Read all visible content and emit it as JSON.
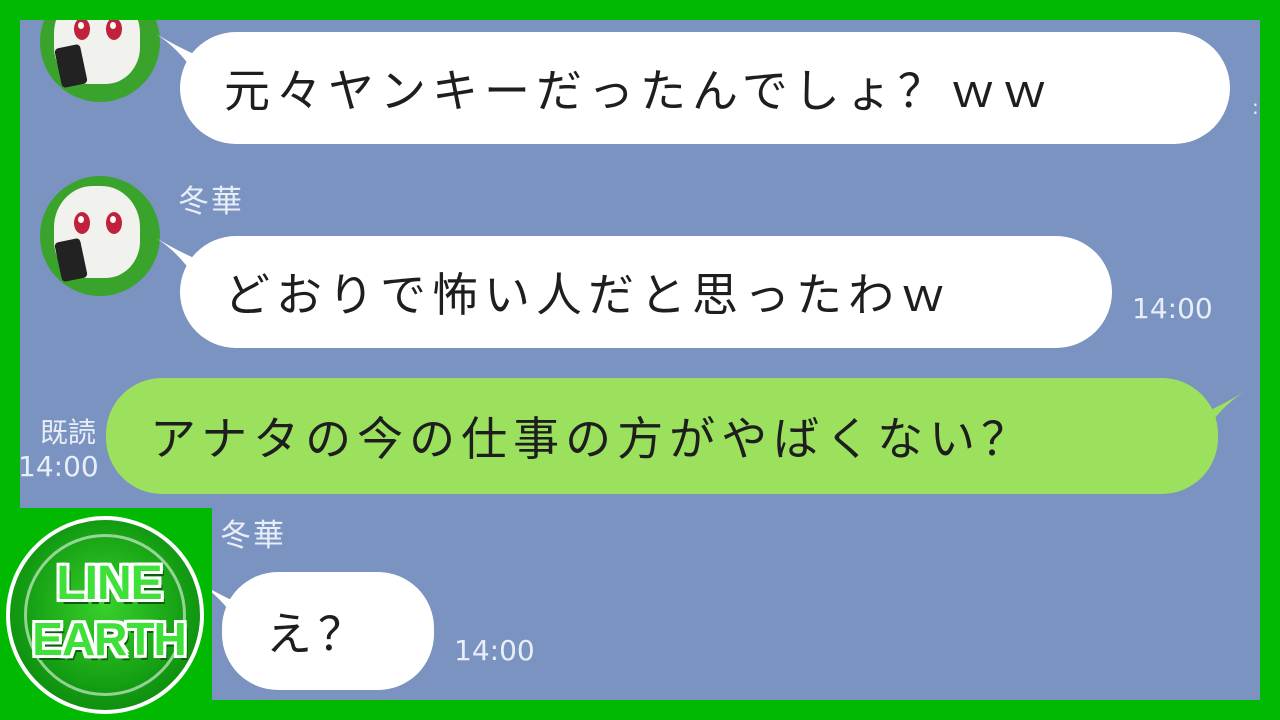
{
  "messages": [
    {
      "text": "元々ヤンキーだったんでしょ？ｗｗ"
    },
    {
      "sender": "冬華",
      "text": "どおりで怖い人だと思ったわｗ",
      "time": "14:00"
    },
    {
      "text": "アナタの今の仕事の方がやばくない？",
      "read": "既読",
      "time": "14:00"
    },
    {
      "sender": "冬華",
      "text": "え？",
      "time": "14:00"
    }
  ],
  "logo": {
    "line1": "LINE",
    "line2": "EARTH"
  },
  "colors": {
    "frame": "#00b900",
    "chat_background": "#7a93c0",
    "incoming_bubble": "#ffffff",
    "outgoing_bubble": "#9be15e"
  },
  "icons": [
    "avatar-character-icon",
    "line-earth-logo-icon"
  ]
}
